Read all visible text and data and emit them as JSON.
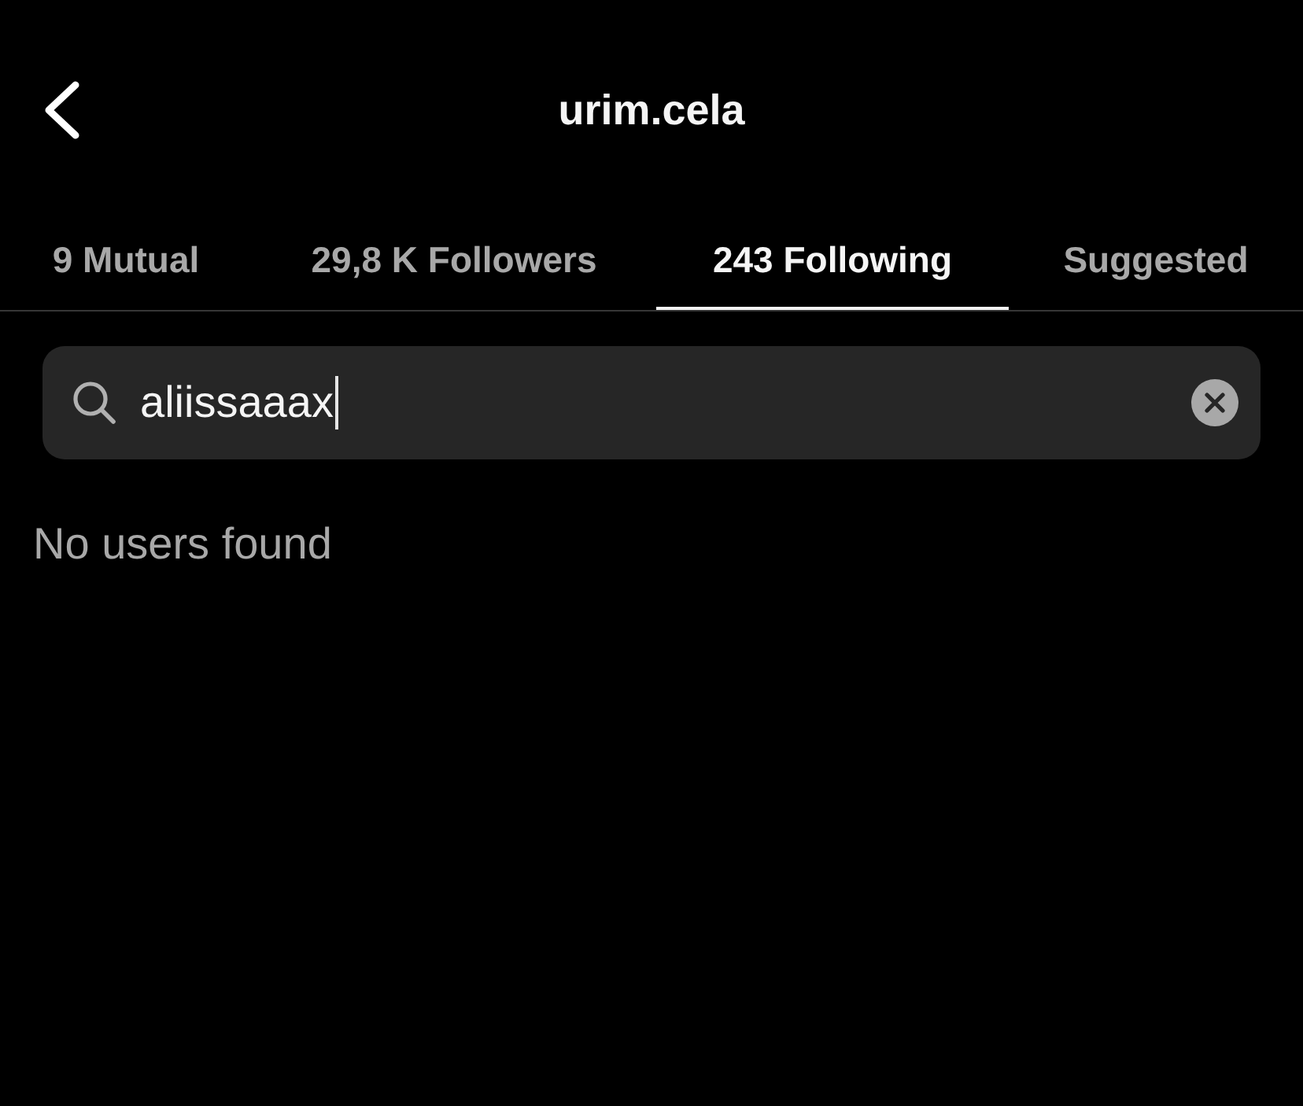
{
  "header": {
    "title": "urim.cela"
  },
  "tabs": [
    {
      "label": "9 Mutual",
      "selected": false
    },
    {
      "label": "29,8 K Followers",
      "selected": false
    },
    {
      "label": "243 Following",
      "selected": true
    },
    {
      "label": "Suggested",
      "selected": false
    }
  ],
  "search": {
    "value": "aliissaaax"
  },
  "message": "No users found"
}
